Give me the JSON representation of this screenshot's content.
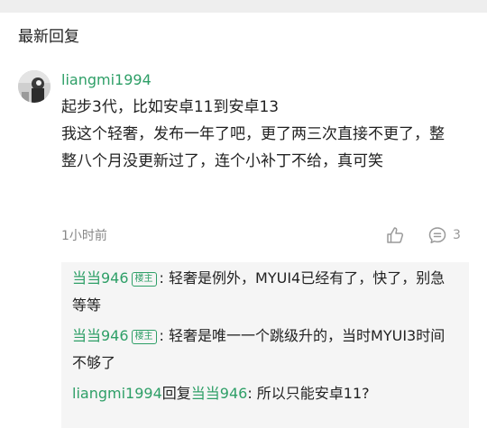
{
  "section": {
    "title": "最新回复"
  },
  "comment": {
    "username": "liangmi1994",
    "lines": [
      "起步3代，比如安卓11到安卓13",
      "我这个轻奢，发布一年了吧，更了两三次直接不更了，整整八个月没更新过了，连个小补丁不给，真可笑"
    ],
    "time": "1小时前",
    "reply_count": "3",
    "icons": {
      "like": "thumbs-up-icon",
      "reply": "comment-bubble-icon"
    }
  },
  "replies": [
    {
      "author": "当当946",
      "badge": "楼主",
      "separator": ":",
      "text": " 轻奢是例外，MYUI4已经有了，快了，别急等等"
    },
    {
      "author": "当当946",
      "badge": "楼主",
      "separator": ":",
      "text": " 轻奢是唯一一个跳级升的，当时MYUI3时间不够了"
    },
    {
      "author": "liangmi1994",
      "reply_word": "回复",
      "target": "当当946",
      "separator": ":",
      "text": " 所以只能安卓11?"
    }
  ],
  "colors": {
    "accent_green": "#2e9f67",
    "secondary_text": "#888888",
    "reply_background": "#f5f5f5",
    "divider": "#eeeeee"
  }
}
